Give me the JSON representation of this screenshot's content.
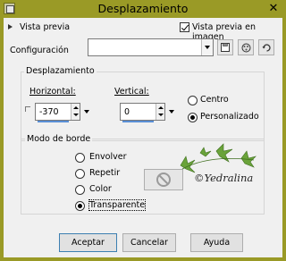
{
  "window": {
    "title": "Desplazamiento",
    "close_glyph": "✕"
  },
  "preview": {
    "label": "Vista previa",
    "image_preview_label": "Vista previa en imagen",
    "image_preview_checked": true
  },
  "config": {
    "label": "Configuración",
    "value": ""
  },
  "toolbar": {
    "save_icon": "save-icon",
    "presets_icon": "presets-icon",
    "reset_icon": "reset-icon"
  },
  "offset": {
    "group_title": "Desplazamiento",
    "horizontal_label": "Horizontal:",
    "horizontal_value": "-370",
    "vertical_label": "Vertical:",
    "vertical_value": "0",
    "center_label": "Centro",
    "custom_label": "Personalizado",
    "selected": "custom"
  },
  "edge": {
    "group_title": "Modo de borde",
    "options": [
      "Envolver",
      "Repetir",
      "Color",
      "Transparente"
    ],
    "selected": "Transparente"
  },
  "watermark": {
    "text": "©Yedralina"
  },
  "buttons": {
    "ok": "Aceptar",
    "cancel": "Cancelar",
    "help": "Ayuda"
  },
  "colors": {
    "titlebar": "#9a9a26",
    "dialog_bg": "#f0f0f0",
    "focus_border": "#3c7fb1"
  }
}
